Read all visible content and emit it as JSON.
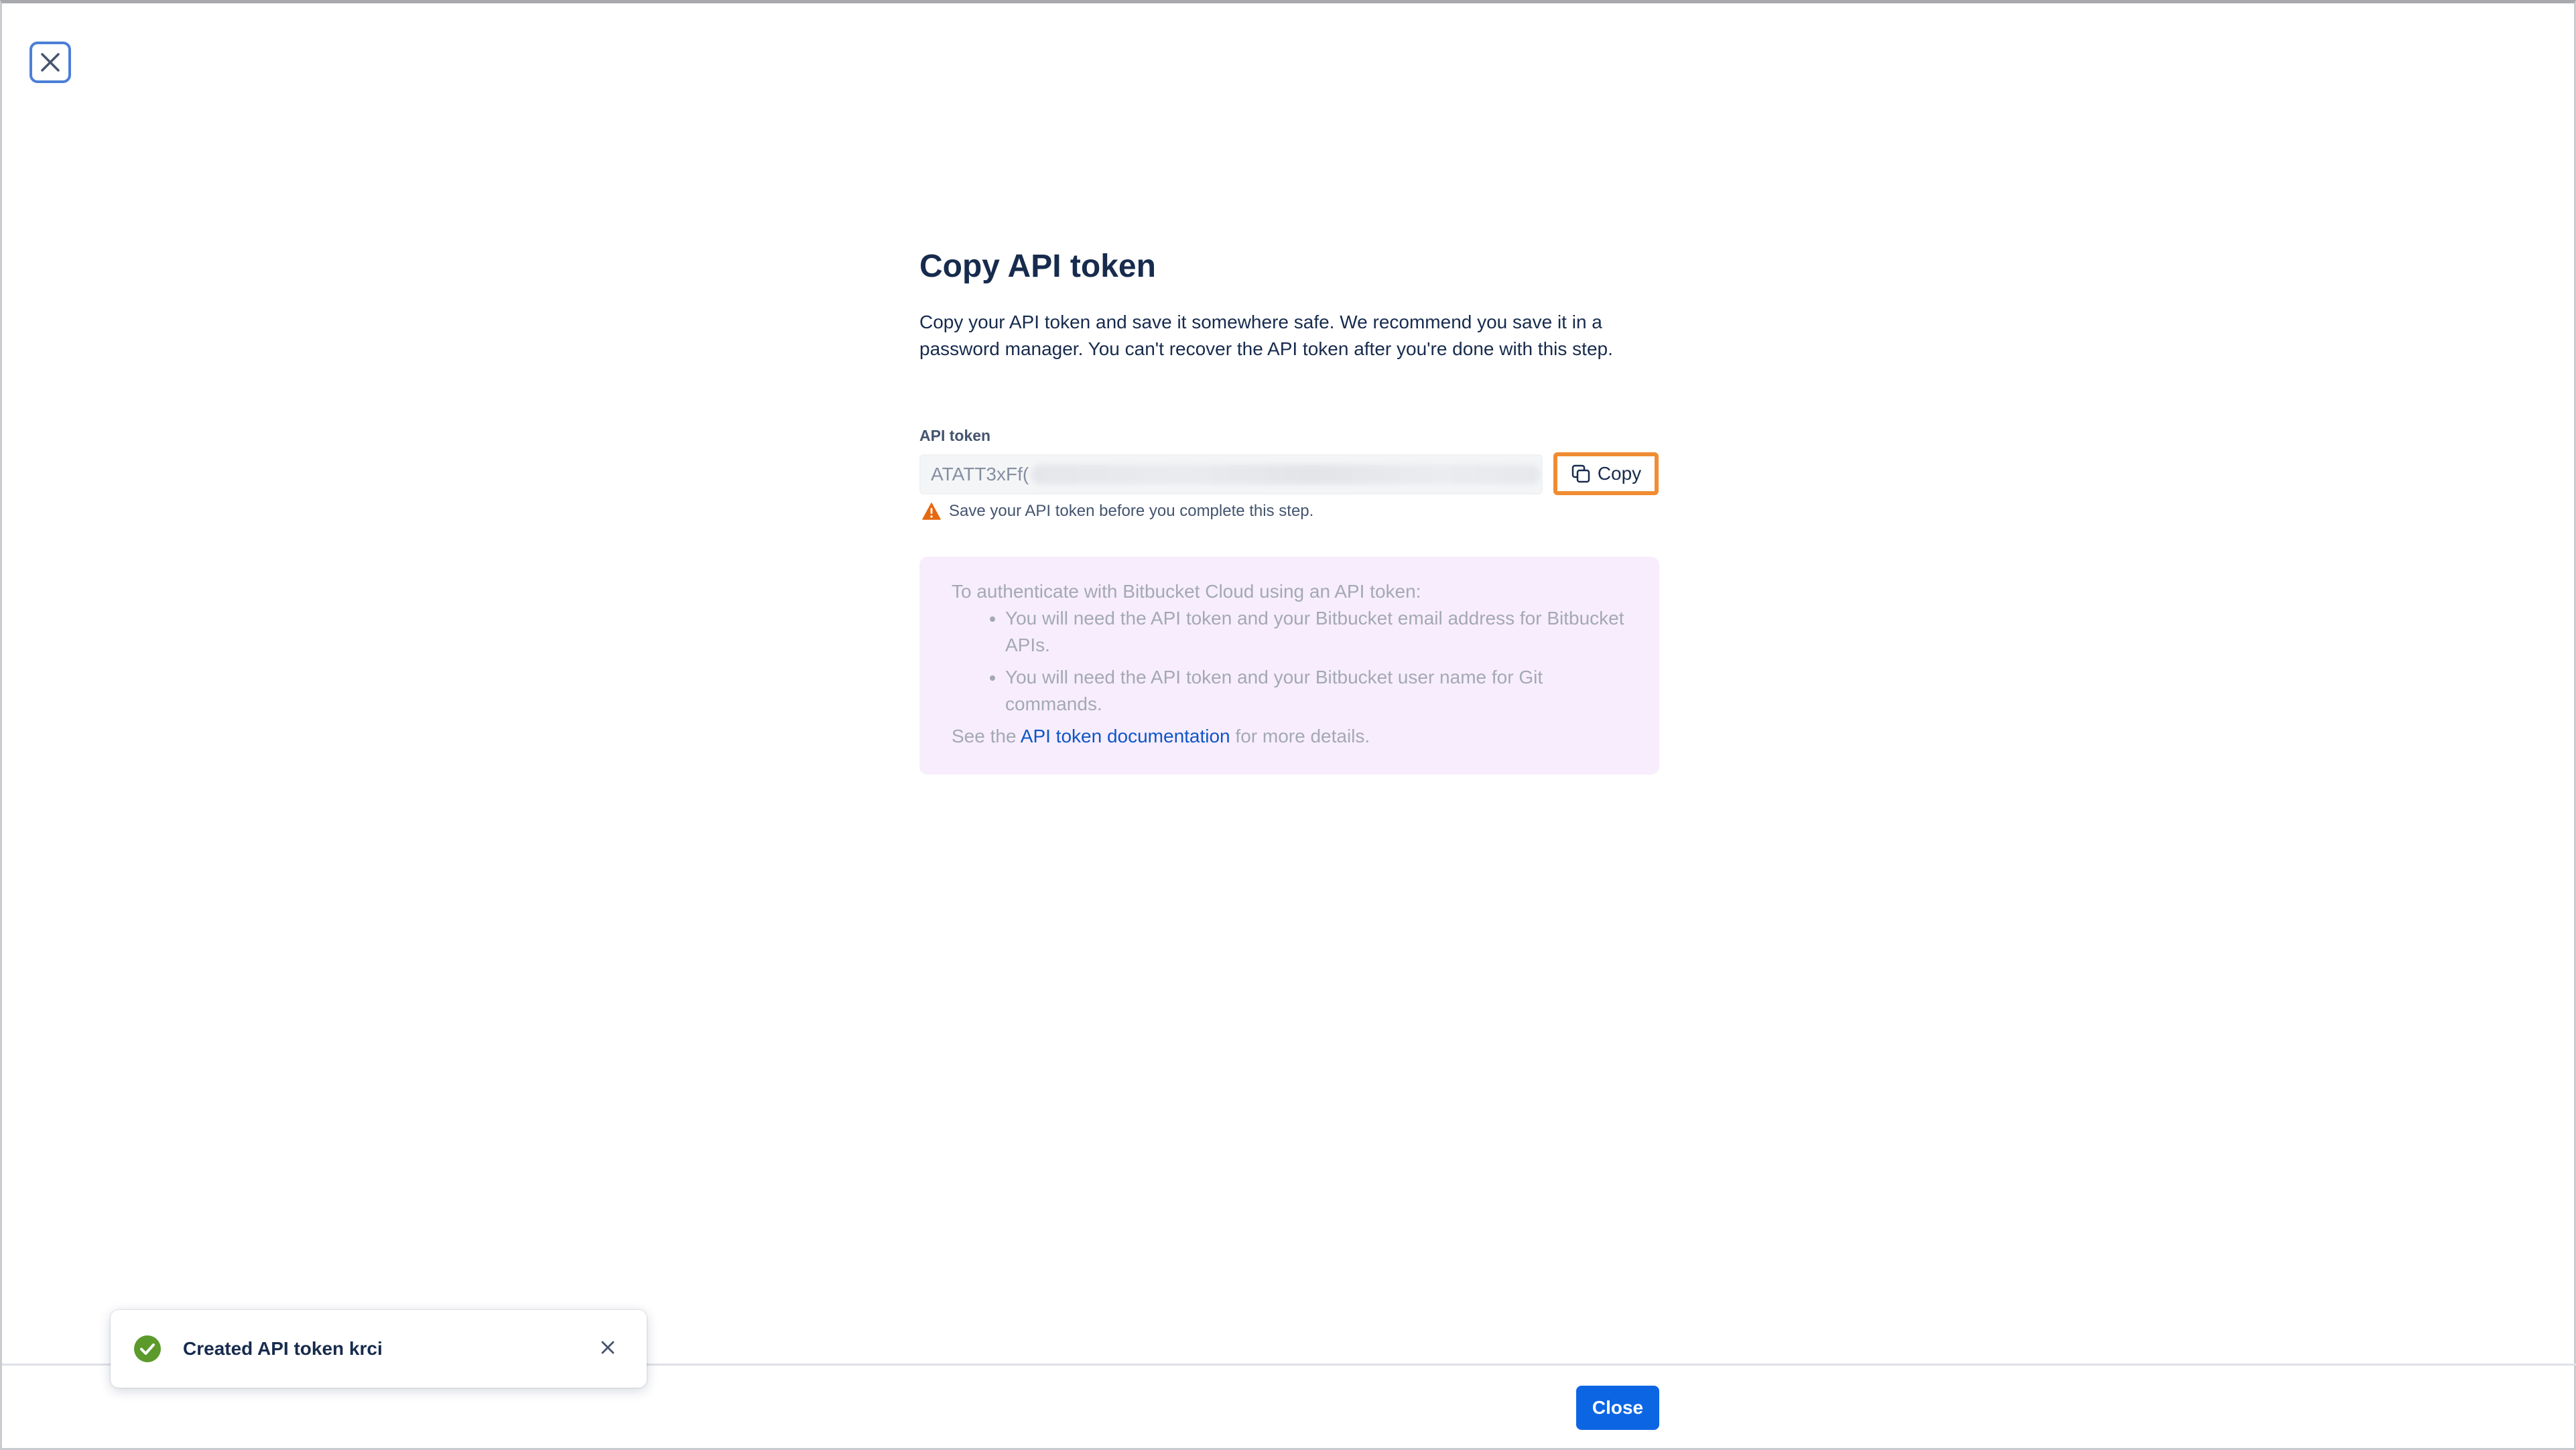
{
  "dialog": {
    "title": "Copy API token",
    "description": "Copy your API token and save it somewhere safe. We recommend you save it in a password manager. You can't recover the API token after you're done with this step."
  },
  "token_field": {
    "label": "API token",
    "value_prefix": "ATATT3xFf(",
    "copy_label": "Copy",
    "warning": "Save your API token before you complete this step."
  },
  "info": {
    "intro": "To authenticate with Bitbucket Cloud using an API token:",
    "bullets": [
      "You will need the API token and your Bitbucket email address for Bitbucket APIs.",
      "You will need the API token and your Bitbucket user name for Git commands."
    ],
    "see_prefix": "See the ",
    "link_text": "API token documentation",
    "see_suffix": " for more details."
  },
  "footer": {
    "close_label": "Close"
  },
  "toast": {
    "message": "Created API token krci"
  },
  "colors": {
    "primary": "#0c66e4",
    "highlight": "#f08c32",
    "success": "#5b9a2b",
    "warning": "#e56910",
    "panel_bg": "#f8edfc",
    "link": "#0c56c8"
  },
  "icons": {
    "dialog_close": "close-icon",
    "copy": "copy-icon",
    "warning": "warning-icon",
    "toast_status": "check-circle-icon",
    "toast_dismiss": "close-icon"
  }
}
